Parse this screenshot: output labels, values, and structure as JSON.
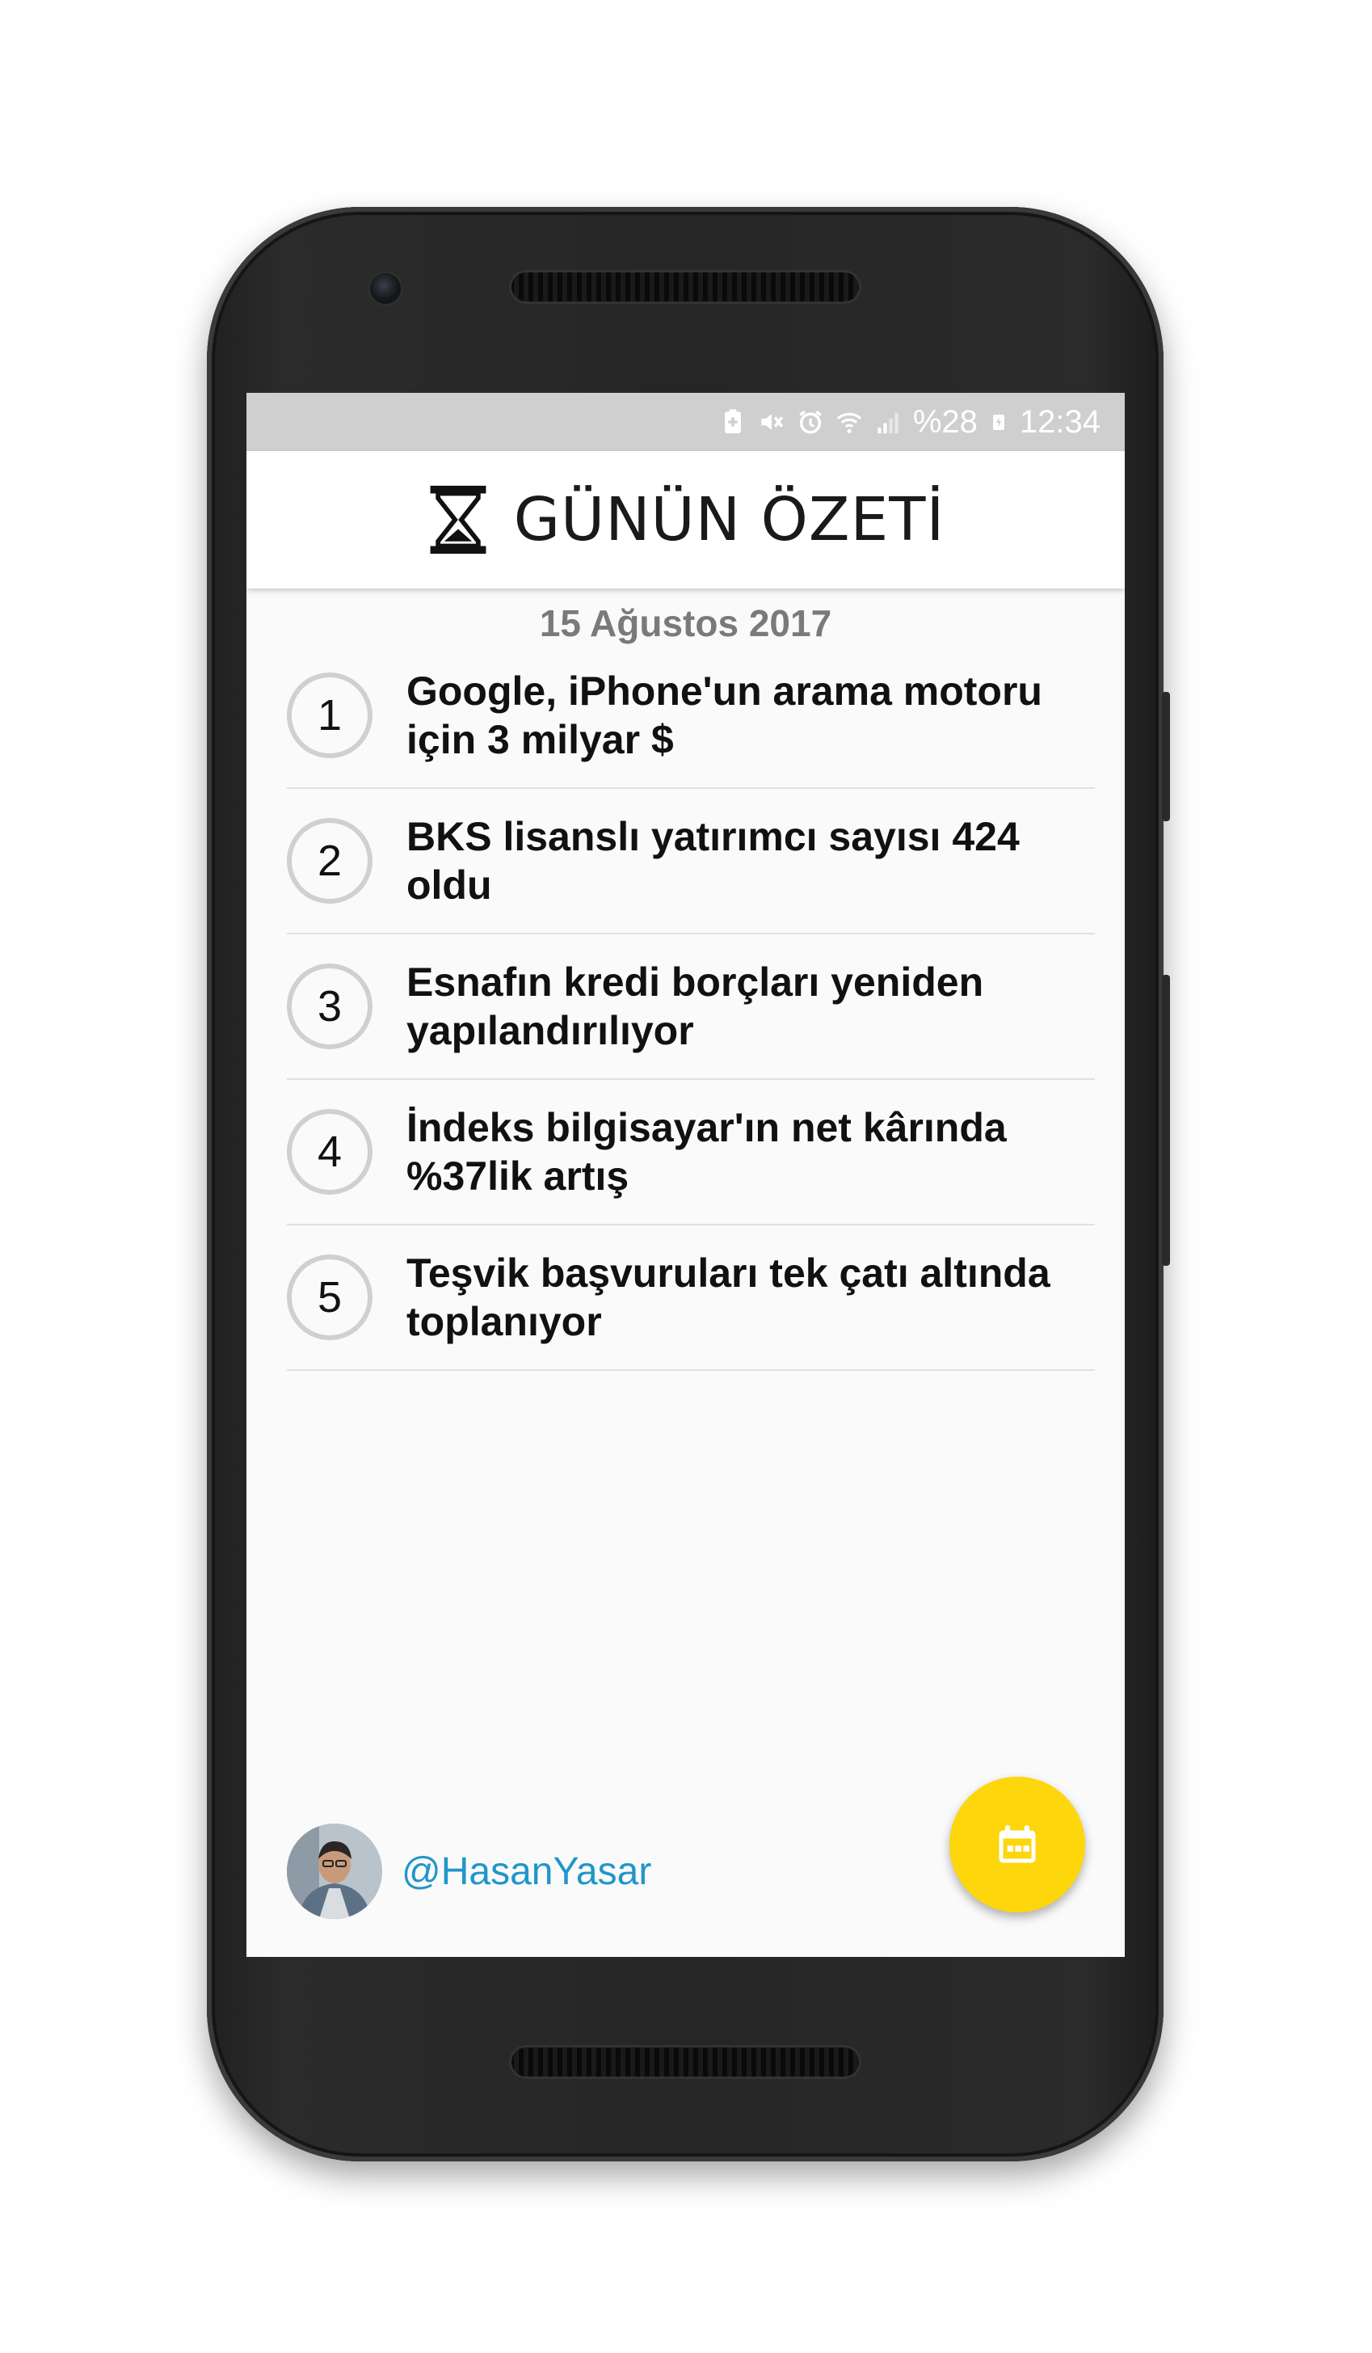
{
  "status_bar": {
    "battery_percent": "%28",
    "time": "12:34",
    "icons": [
      "battery-saver-icon",
      "mute-icon",
      "alarm-icon",
      "wifi-icon",
      "signal-icon",
      "charging-icon"
    ]
  },
  "app_bar": {
    "logo_icon": "hourglass-icon",
    "title": "GÜNÜN ÖZETİ"
  },
  "date": "15 Ağustos 2017",
  "headlines": [
    {
      "number": "1",
      "text": "Google, iPhone'un arama motoru için 3 milyar $"
    },
    {
      "number": "2",
      "text": "BKS lisanslı yatırımcı sayısı 424 oldu"
    },
    {
      "number": "3",
      "text": "Esnafın kredi borçları yeniden yapılandırılıyor"
    },
    {
      "number": "4",
      "text": "İndeks bilgisayar'ın net kârında %37lik artış"
    },
    {
      "number": "5",
      "text": "Teşvik başvuruları tek çatı altında toplanıyor"
    }
  ],
  "author": {
    "handle": "@HasanYasar"
  },
  "fab": {
    "icon": "calendar-icon"
  },
  "colors": {
    "fab": "#fdd60c",
    "handle": "#2196c9",
    "status_bar": "#cfcfcf"
  }
}
